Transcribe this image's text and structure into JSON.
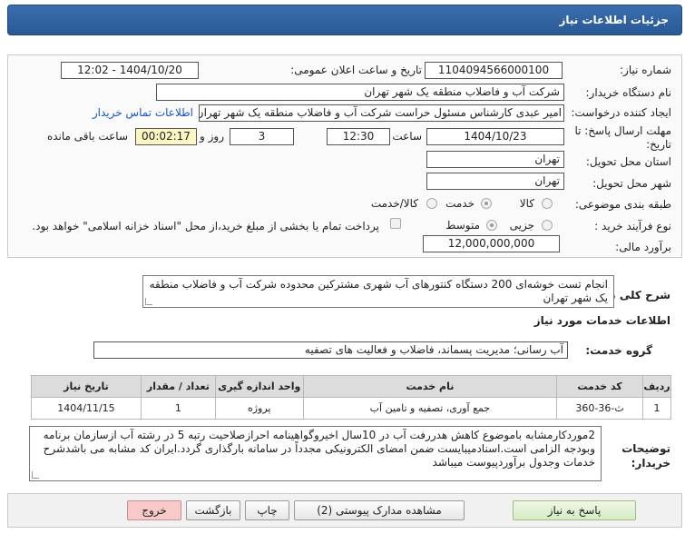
{
  "header": {
    "title": "جزئیات اطلاعات نیاز"
  },
  "fields": {
    "need_number": {
      "label": "شماره نیاز:",
      "value": "1104094566000100"
    },
    "announce_datetime": {
      "label": "تاریخ و ساعت اعلان عمومی:",
      "value": "1404/10/20 - 12:02"
    },
    "buyer_org": {
      "label": "نام دستگاه خریدار:",
      "value": "شرکت آب و فاضلاب منطقه یک شهر تهران"
    },
    "requester": {
      "label": "ایجاد کننده درخواست:",
      "value": "امیر عبدی کارشناس مسئول حراست شرکت آب و فاضلاب منطقه یک شهر تهران",
      "contact_link": "اطلاعات تماس خریدار"
    },
    "deadline": {
      "label_line1": "مهلت ارسال پاسخ: تا",
      "label_line2": "تاریخ:",
      "date": "1404/10/23",
      "time_label": "ساعت",
      "time": "12:30",
      "days": "3",
      "days_label": "روز و",
      "remaining": "00:02:17",
      "remaining_label": "ساعت باقی مانده"
    },
    "delivery_province": {
      "label": "استان محل تحویل:",
      "value": "تهران"
    },
    "delivery_city": {
      "label": "شهر محل تحویل:",
      "value": "تهران"
    },
    "category": {
      "label": "طبقه بندی موضوعی:",
      "options": [
        "کالا",
        "خدمت",
        "کالا/خدمت"
      ],
      "selected": "خدمت"
    },
    "purchase_type": {
      "label": "نوع فرآیند خرید :",
      "options": [
        "جزیی",
        "متوسط"
      ],
      "selected": "متوسط",
      "checkbox_note": "پرداخت تمام یا بخشی از مبلغ خرید،از محل \"اسناد خزانه اسلامی\" خواهد بود."
    },
    "budget": {
      "label": "برآورد مالی:",
      "value": "12,000,000,000"
    }
  },
  "summary": {
    "label": "شرح کلی نیاز:",
    "value": "انجام تست خوشه‌ای 200 دستگاه کنتورهای آب شهری مشترکین  محدوده شرکت آب و فاضلاب منطقه یک شهر تهران"
  },
  "services": {
    "title": "اطلاعات خدمات مورد نیاز",
    "group_label": "گروه خدمت:",
    "group_value": "آب رسانی؛ مدیریت پسماند، فاضلاب و فعالیت های تصفیه",
    "columns": [
      "ردیف",
      "کد خدمت",
      "نام خدمت",
      "واحد اندازه گیری",
      "تعداد / مقدار",
      "تاریخ نیاز"
    ],
    "rows": [
      [
        "1",
        "ث-36-360",
        "جمع آوری، تصفیه و تامین آب",
        "پروژه",
        "1",
        "1404/11/15"
      ]
    ]
  },
  "buyer_notes": {
    "label_line1": "توضیحات",
    "label_line2": "خریدار:",
    "value": "2موردکارمشابه باموضوع کاهش هدررفت آب در 10سال اخیروگواهینامه احرازصلاحیت رتبه 5 در رشته آب ازسازمان برنامه وبودجه الزامی است.اسنادمیبایست ضمن امضای الکترونیکی مجدداً در سامانه بارگذاری گردد.ایران کد مشابه می باشدشرح خدمات وجدول برآوردپیوست میباشد"
  },
  "buttons": {
    "reply": "پاسخ به نیاز",
    "view_attachments": "مشاهده مدارک پیوستی (2)",
    "print": "چاپ",
    "back": "بازگشت",
    "exit": "خروج"
  }
}
